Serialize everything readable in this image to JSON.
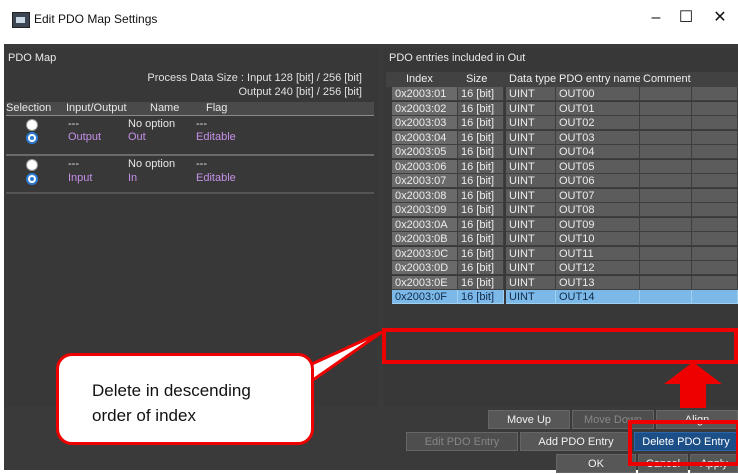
{
  "window": {
    "title": "Edit PDO Map Settings",
    "minimize": "–",
    "maximize": "☐",
    "close": "✕"
  },
  "left": {
    "title": "PDO Map",
    "size_line1": "Process Data Size : Input  128 [bit]  /  256 [bit]",
    "size_line2": "Output  240 [bit]  /  256 [bit]",
    "headers": [
      "Selection",
      "Input/Output",
      "Name",
      "Flag"
    ],
    "groups": [
      {
        "rows": [
          {
            "io": "---",
            "name": "No option",
            "flag": "---",
            "selected": false
          },
          {
            "io": "Output",
            "name": "Out",
            "flag": "Editable",
            "selected": true
          }
        ]
      },
      {
        "rows": [
          {
            "io": "---",
            "name": "No option",
            "flag": "---",
            "selected": false
          },
          {
            "io": "Input",
            "name": "In",
            "flag": "Editable",
            "selected": true
          }
        ]
      }
    ]
  },
  "right": {
    "title": "PDO entries included in Out",
    "headers": [
      "Index",
      "Size",
      "Data type",
      "PDO entry name",
      "Comment"
    ],
    "rows": [
      {
        "index": "0x2003:01",
        "size": "16 [bit]",
        "type": "UINT",
        "name": "OUT00"
      },
      {
        "index": "0x2003:02",
        "size": "16 [bit]",
        "type": "UINT",
        "name": "OUT01"
      },
      {
        "index": "0x2003:03",
        "size": "16 [bit]",
        "type": "UINT",
        "name": "OUT02"
      },
      {
        "index": "0x2003:04",
        "size": "16 [bit]",
        "type": "UINT",
        "name": "OUT03"
      },
      {
        "index": "0x2003:05",
        "size": "16 [bit]",
        "type": "UINT",
        "name": "OUT04"
      },
      {
        "index": "0x2003:06",
        "size": "16 [bit]",
        "type": "UINT",
        "name": "OUT05"
      },
      {
        "index": "0x2003:07",
        "size": "16 [bit]",
        "type": "UINT",
        "name": "OUT06"
      },
      {
        "index": "0x2003:08",
        "size": "16 [bit]",
        "type": "UINT",
        "name": "OUT07"
      },
      {
        "index": "0x2003:09",
        "size": "16 [bit]",
        "type": "UINT",
        "name": "OUT08"
      },
      {
        "index": "0x2003:0A",
        "size": "16 [bit]",
        "type": "UINT",
        "name": "OUT09"
      },
      {
        "index": "0x2003:0B",
        "size": "16 [bit]",
        "type": "UINT",
        "name": "OUT10"
      },
      {
        "index": "0x2003:0C",
        "size": "16 [bit]",
        "type": "UINT",
        "name": "OUT11"
      },
      {
        "index": "0x2003:0D",
        "size": "16 [bit]",
        "type": "UINT",
        "name": "OUT12"
      },
      {
        "index": "0x2003:0E",
        "size": "16 [bit]",
        "type": "UINT",
        "name": "OUT13"
      },
      {
        "index": "0x2003:0F",
        "size": "16 [bit]",
        "type": "UINT",
        "name": "OUT14",
        "selected": true
      }
    ]
  },
  "buttons": {
    "move_up": "Move Up",
    "move_down": "Move Down",
    "align": "Align",
    "edit_entry": "Edit PDO Entry",
    "add_entry": "Add PDO Entry",
    "delete_entry": "Delete PDO Entry",
    "ok": "OK",
    "cancel": "Cancel",
    "apply": "Apply"
  },
  "annotation": {
    "line1": "Delete in descending",
    "line2": "order of index"
  },
  "colors": {
    "panel_bg": "#383838",
    "selected_row": "#7db9e8",
    "editable_text": "#c490e8",
    "highlight_red": "#e00000",
    "selected_button": "#1c4e88"
  }
}
